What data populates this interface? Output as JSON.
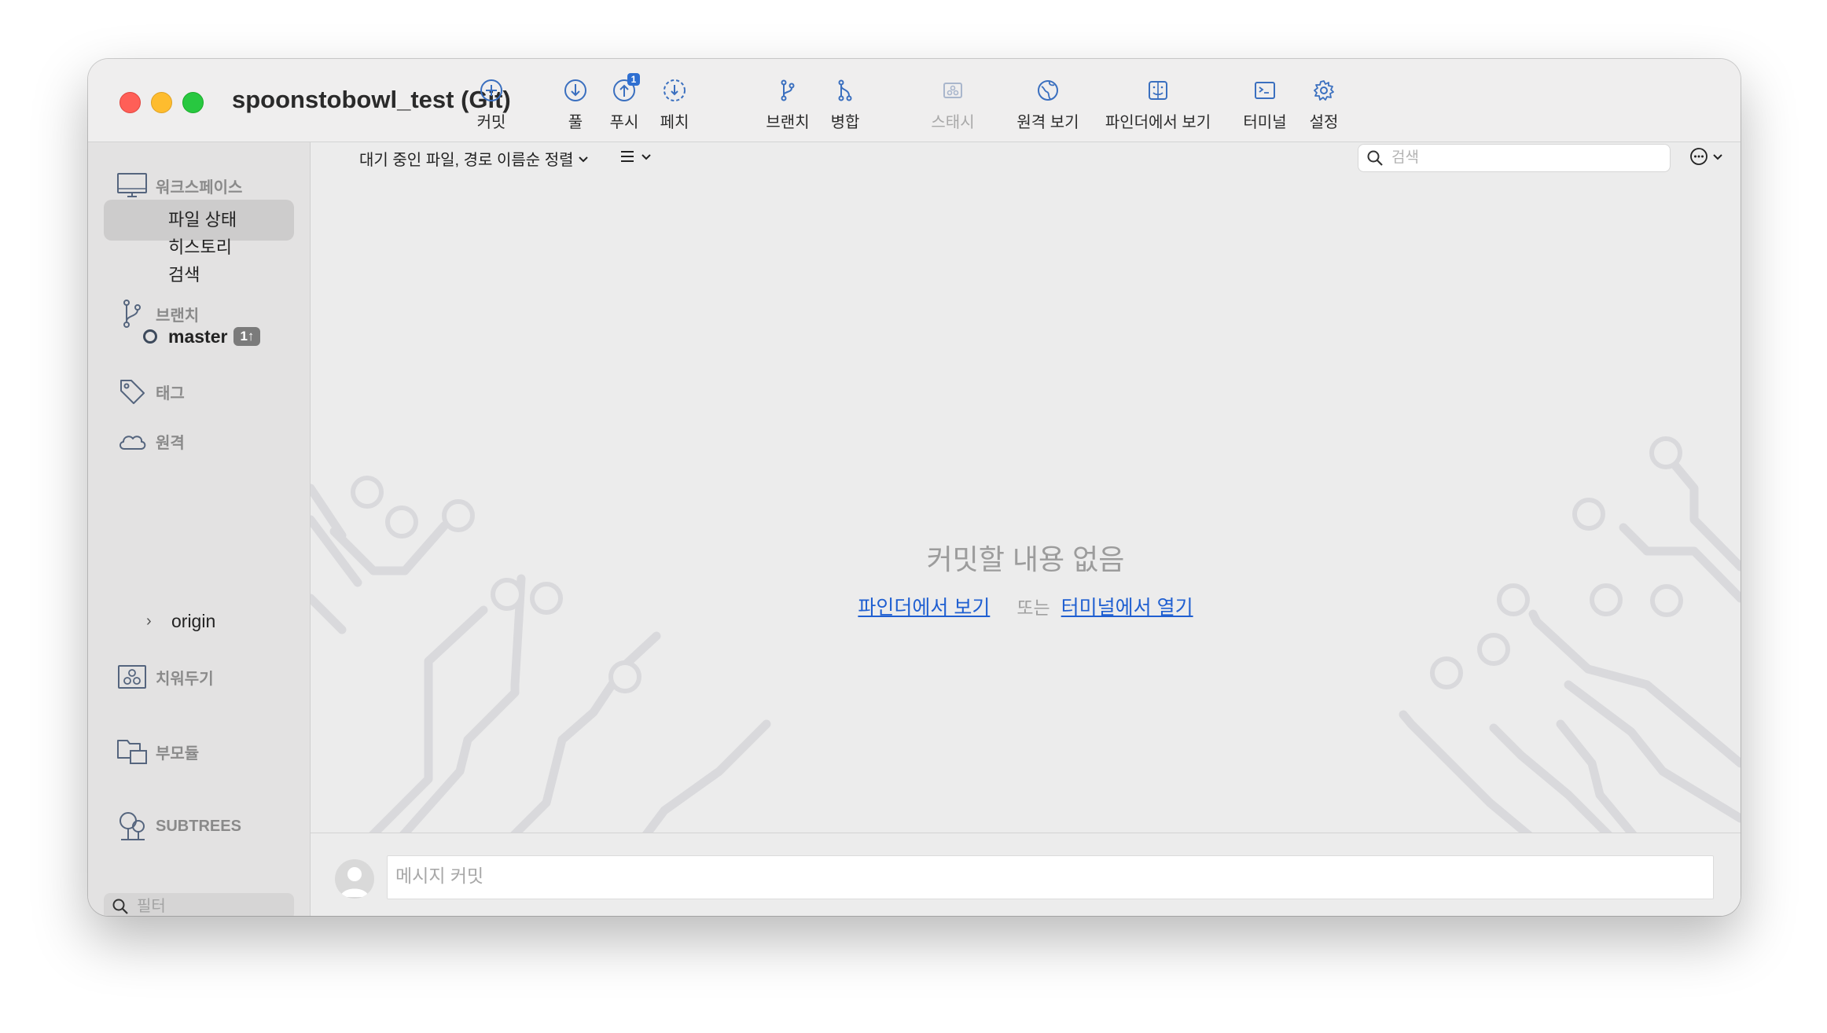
{
  "window": {
    "title": "spoonstobowl_test (Git)"
  },
  "toolbar": {
    "commit": "커밋",
    "pull": "풀",
    "push": "푸시",
    "push_badge": "1",
    "fetch": "페치",
    "branch": "브랜치",
    "merge": "병합",
    "stash": "스태시",
    "remote_view": "원격 보기",
    "finder_view": "파인더에서 보기",
    "terminal": "터미널",
    "settings": "설정"
  },
  "sidebar": {
    "workspace": {
      "header": "워크스페이스",
      "items": [
        "파일 상태",
        "히스토리",
        "검색"
      ],
      "selected": "파일 상태"
    },
    "branches": {
      "header": "브랜치",
      "current": "master",
      "badge": "1↑"
    },
    "tags": {
      "header": "태그"
    },
    "remotes": {
      "header": "원격",
      "items": [
        "origin"
      ]
    },
    "stashes": {
      "header": "치워두기"
    },
    "submodules": {
      "header": "부모듈"
    },
    "subtrees": {
      "header": "SUBTREES"
    },
    "filter_placeholder": "필터"
  },
  "main": {
    "sort_label": "대기 중인 파일, 경로 이름순 정렬",
    "search_placeholder": "검색",
    "empty_title": "커밋할 내용 없음",
    "link_finder": "파인더에서 보기",
    "or": "또는",
    "link_terminal": "터미널에서 열기",
    "commit_placeholder": "메시지 커밋"
  },
  "colors": {
    "accent": "#1f5fd1",
    "icon_blue": "#3a6fbf",
    "badge_blue": "#2f6fd1"
  }
}
